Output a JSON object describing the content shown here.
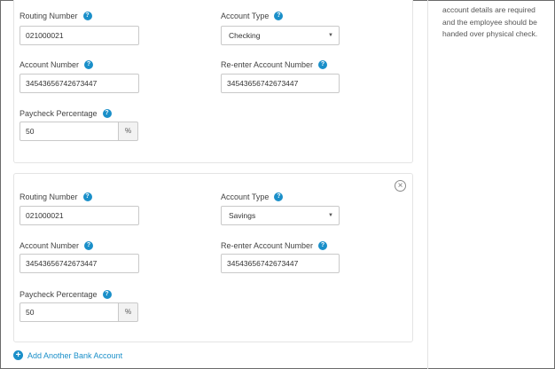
{
  "side_note": "account details are required and the employee should be handed over physical check.",
  "labels": {
    "routing": "Routing Number",
    "account_type": "Account Type",
    "account_number": "Account Number",
    "reenter": "Re-enter Account Number",
    "percentage": "Paycheck Percentage",
    "help": "?",
    "percent_suffix": "%"
  },
  "accounts": [
    {
      "routing_number": "021000021",
      "account_type": "Checking",
      "account_number": "34543656742673447",
      "reenter_account_number": "34543656742673447",
      "paycheck_percentage": "50"
    },
    {
      "routing_number": "021000021",
      "account_type": "Savings",
      "account_number": "34543656742673447",
      "reenter_account_number": "34543656742673447",
      "paycheck_percentage": "50"
    }
  ],
  "add_link": "Add Another Bank Account",
  "icons": {
    "help": "question-circle-icon",
    "remove": "close-circle-icon",
    "add": "plus-circle-icon",
    "caret": "caret-down-icon"
  },
  "colors": {
    "accent": "#1a8fc9"
  }
}
